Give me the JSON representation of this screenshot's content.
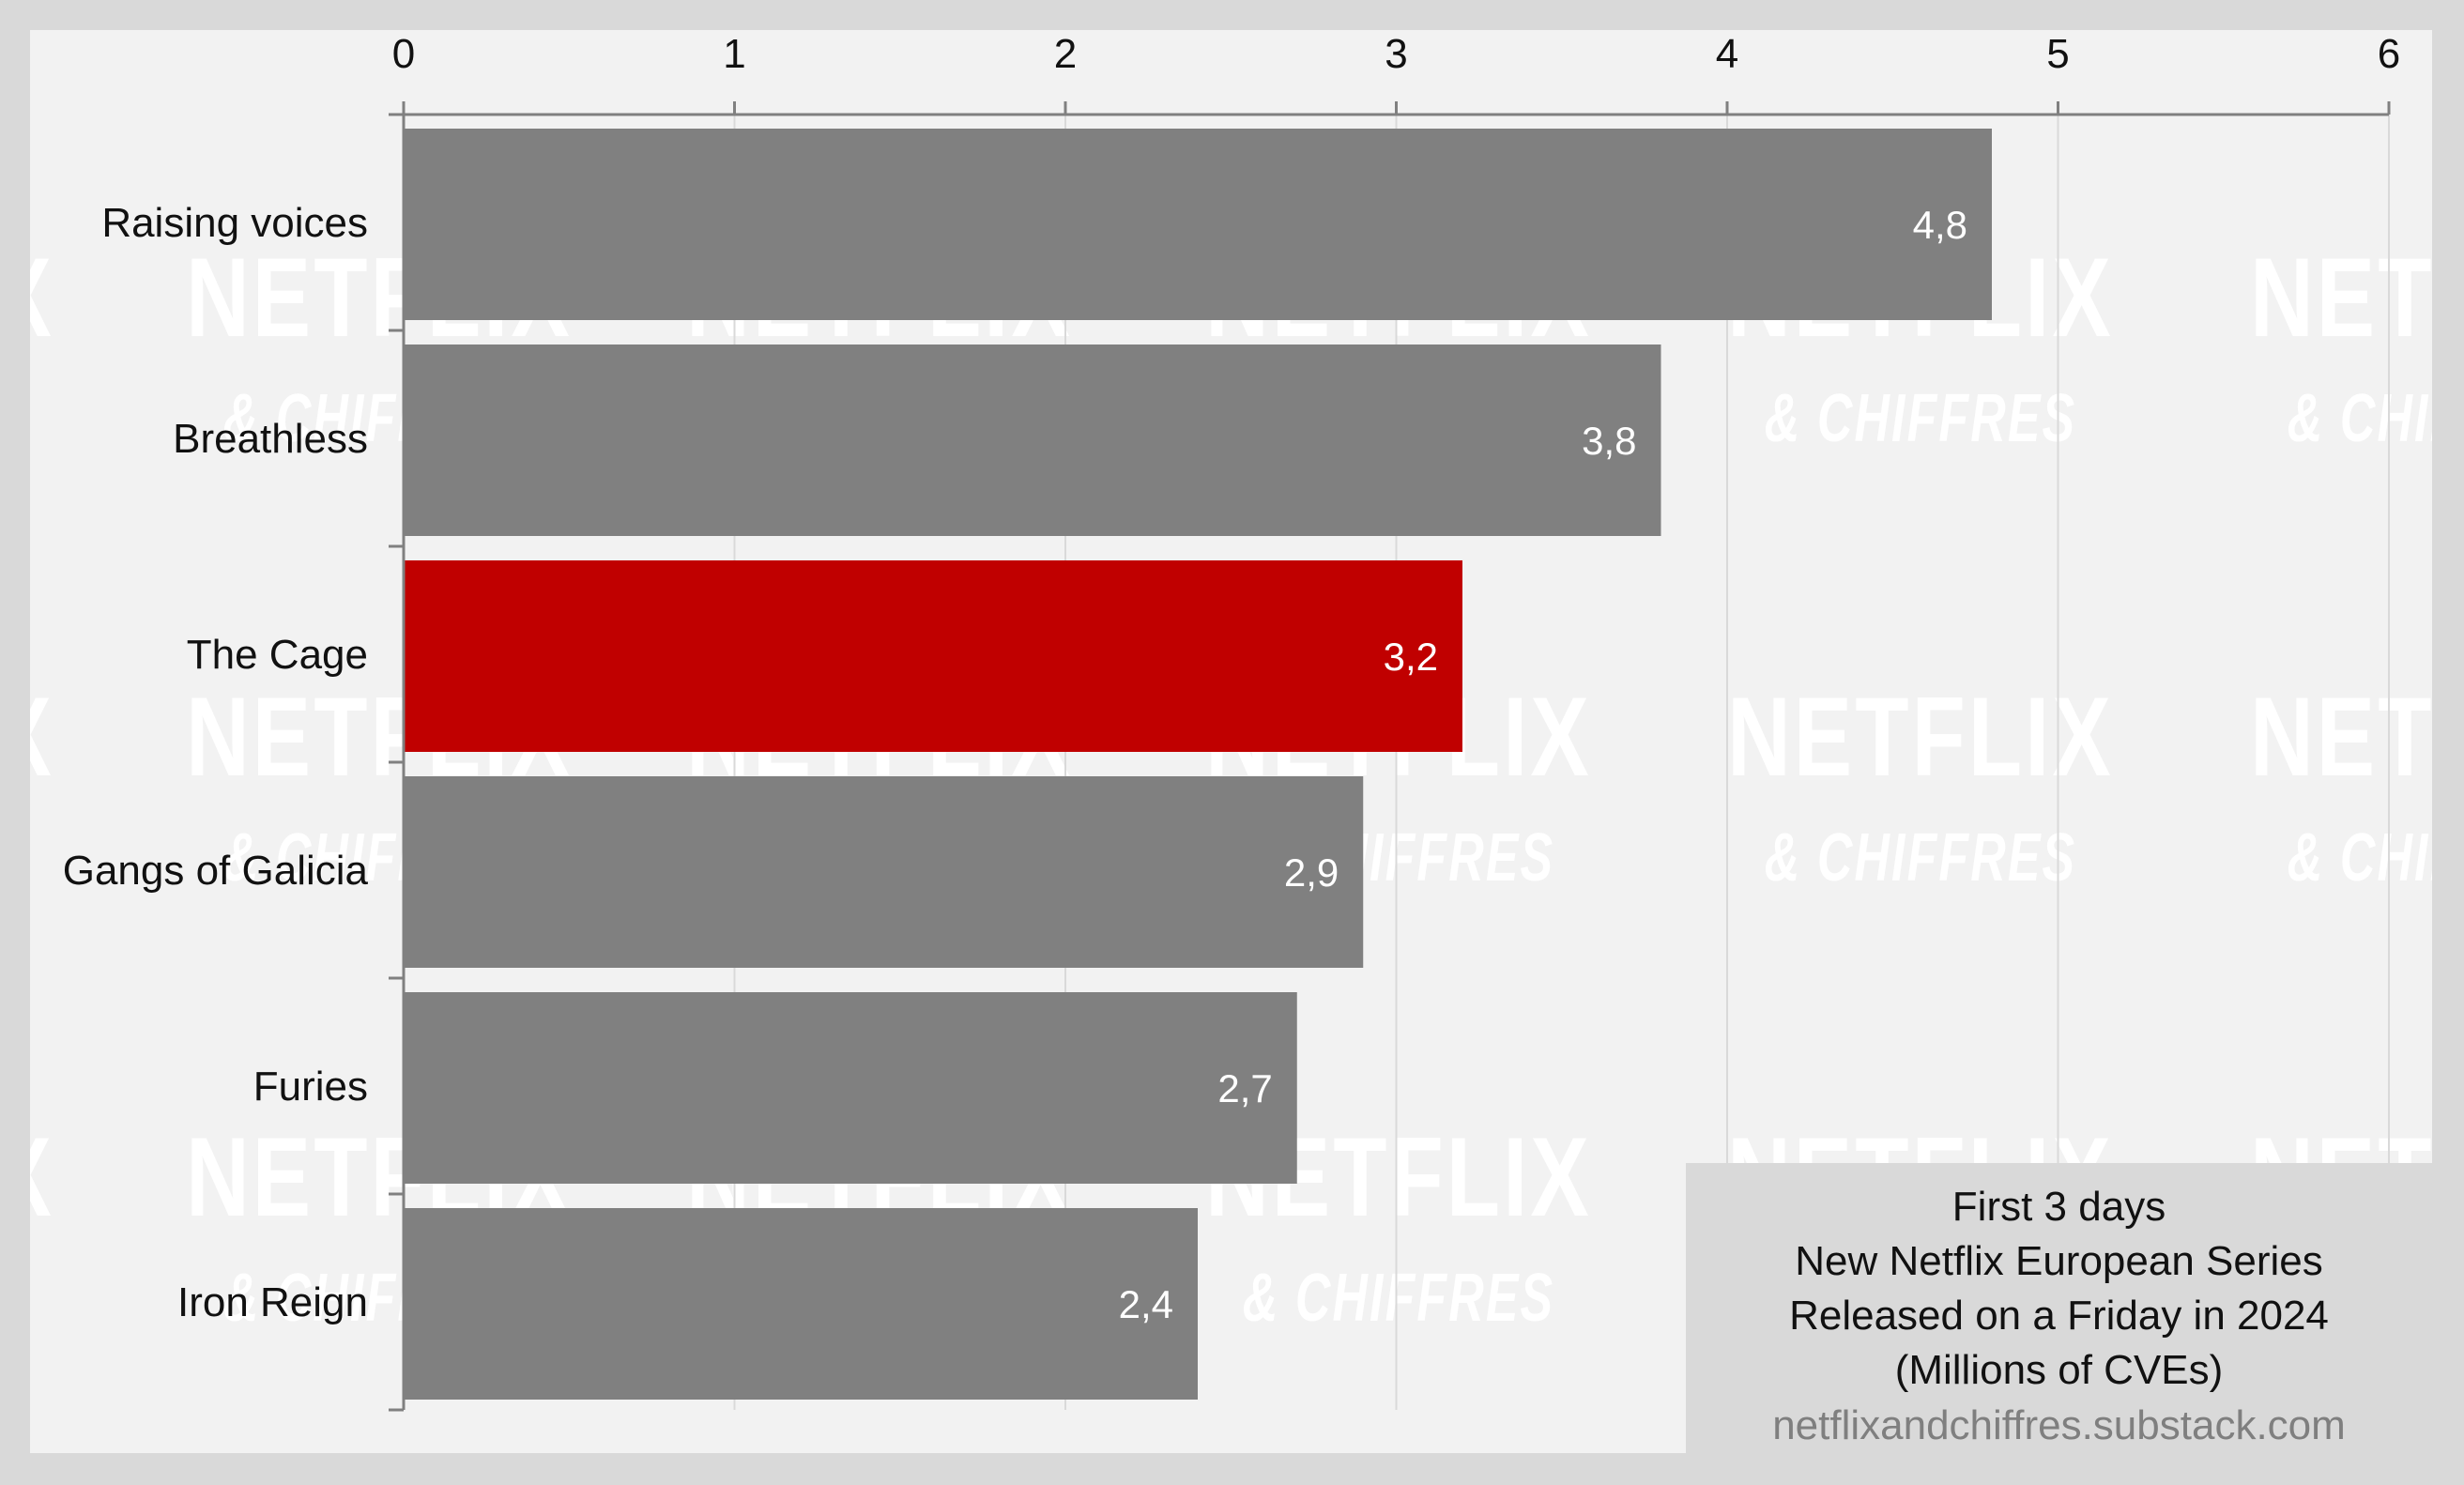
{
  "chart_data": {
    "type": "bar",
    "orientation": "horizontal",
    "title": "First 3 days",
    "subtitle_lines": [
      "New Netflix European Series",
      "Released on a Friday in 2024",
      "(Millions of CVEs)"
    ],
    "source": "netflixandchiffres.substack.com",
    "xlabel": "",
    "ylabel": "",
    "xlim": [
      0,
      6
    ],
    "x_ticks": [
      "0",
      "1",
      "2",
      "3",
      "4",
      "5",
      "6"
    ],
    "x_axis_position": "top",
    "grid": true,
    "categories": [
      "Raising voices",
      "Breathless",
      "The Cage",
      "Gangs of Galicia",
      "Furies",
      "Iron Reign"
    ],
    "values": [
      4.8,
      3.8,
      3.2,
      2.9,
      2.7,
      2.4
    ],
    "value_labels": [
      "4,8",
      "3,8",
      "3,2",
      "2,9",
      "2,7",
      "2,4"
    ],
    "highlight_index": 2,
    "legend_placement": "bottom-right"
  },
  "colors": {
    "bar": "#808080",
    "highlight": "#c00000",
    "panel_bg": "#f2f2f2",
    "outer_bg": "#d9d9d9",
    "grid": "#d9d9d9",
    "axis": "#808080"
  },
  "watermark": {
    "line1": "NETFLIX",
    "line2": "& CHIFFRES"
  }
}
